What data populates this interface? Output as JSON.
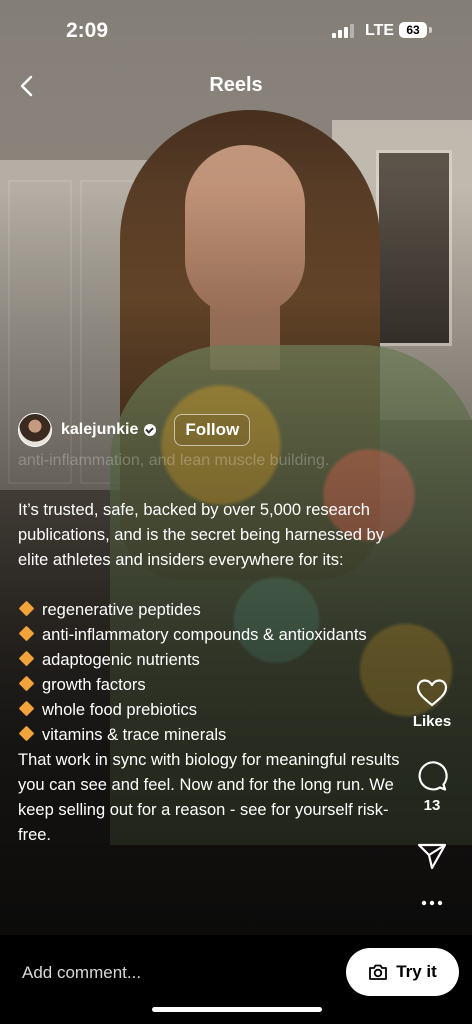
{
  "status_bar": {
    "time": "2:09",
    "network": "LTE",
    "battery": "63"
  },
  "header": {
    "title": "Reels",
    "back_icon": "chevron-left-icon"
  },
  "author": {
    "username": "kalejunkie",
    "verified": true,
    "follow_label": "Follow"
  },
  "overlay_text": "anti-inflammation, and lean muscle building.",
  "caption": {
    "intro": "It’s trusted, safe, backed by over 5,000 research publications, and is the secret being harnessed by elite athletes and insiders everywhere for its:",
    "bullets": [
      "regenerative peptides",
      "anti-inflammatory compounds & antioxidants",
      "adaptogenic nutrients",
      "growth factors",
      "whole food prebiotics",
      "vitamins & trace minerals"
    ],
    "closing": "That work in sync with biology for meaningful results you can see and feel. Now and for the long run. We keep selling out for a reason - see for yourself risk-free."
  },
  "actions": {
    "likes_label": "Likes",
    "comments_count": "13",
    "like_icon": "heart-icon",
    "comment_icon": "comment-bubble-icon",
    "share_icon": "paper-plane-icon",
    "more_icon": "more-horizontal-icon"
  },
  "bottom_bar": {
    "comment_placeholder": "Add comment...",
    "try_it_label": "Try it",
    "try_it_icon": "camera-icon"
  },
  "colors": {
    "bullet": "#f2a33a"
  }
}
